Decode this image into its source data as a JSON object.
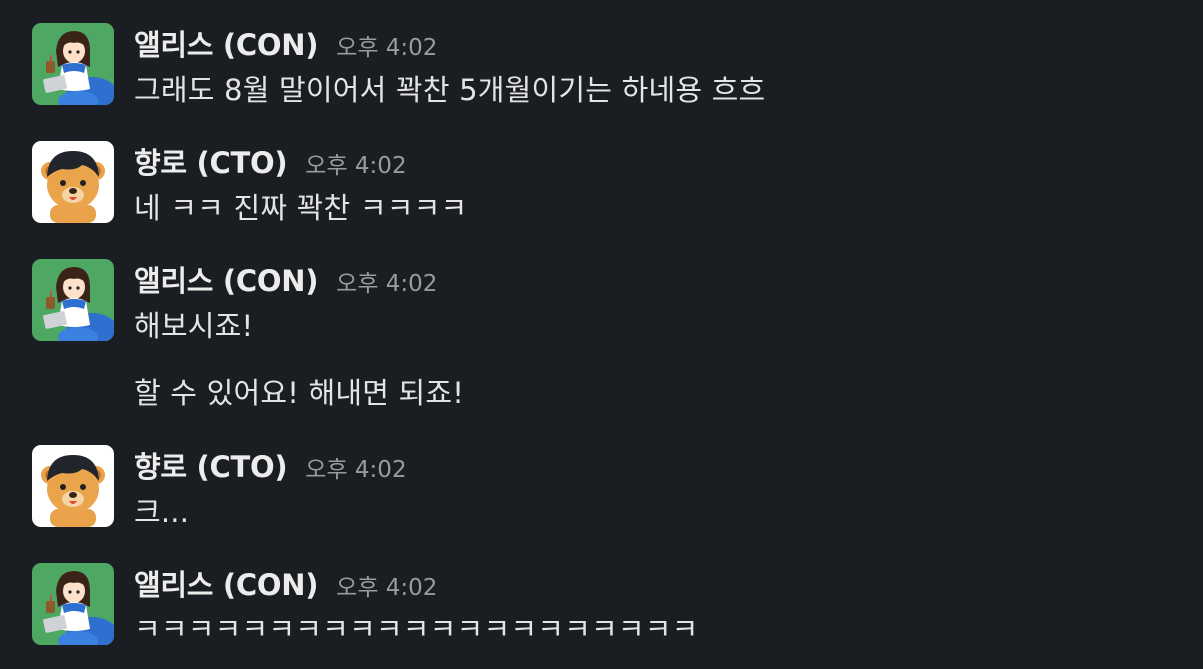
{
  "colors": {
    "background": "#1a1d21",
    "name_text": "#ececec",
    "timestamp_text": "#9a9b9d",
    "message_text": "#e4e4e4",
    "alice_avatar_bg": "#4fa764",
    "bear_avatar_bg": "#ffffff"
  },
  "messages": [
    {
      "avatar": "alice-avatar",
      "author": "앨리스 (CON)",
      "time": "오후 4:02",
      "lines": [
        "그래도 8월 말이어서 꽉찬 5개월이기는 하네용 흐흐"
      ]
    },
    {
      "avatar": "bear-avatar",
      "author": "향로 (CTO)",
      "time": "오후 4:02",
      "lines": [
        "네 ㅋㅋ 진짜 꽉찬 ㅋㅋㅋㅋ"
      ]
    },
    {
      "avatar": "alice-avatar",
      "author": "앨리스 (CON)",
      "time": "오후 4:02",
      "lines": [
        "해보시죠!",
        "할 수 있어요! 해내면 되죠!"
      ]
    },
    {
      "avatar": "bear-avatar",
      "author": "향로 (CTO)",
      "time": "오후 4:02",
      "lines": [
        "크..."
      ]
    },
    {
      "avatar": "alice-avatar",
      "author": "앨리스 (CON)",
      "time": "오후 4:02",
      "lines": [
        "ㅋㅋㅋㅋㅋㅋㅋㅋㅋㅋㅋㅋㅋㅋㅋㅋㅋㅋㅋㅋㅋ"
      ]
    }
  ]
}
